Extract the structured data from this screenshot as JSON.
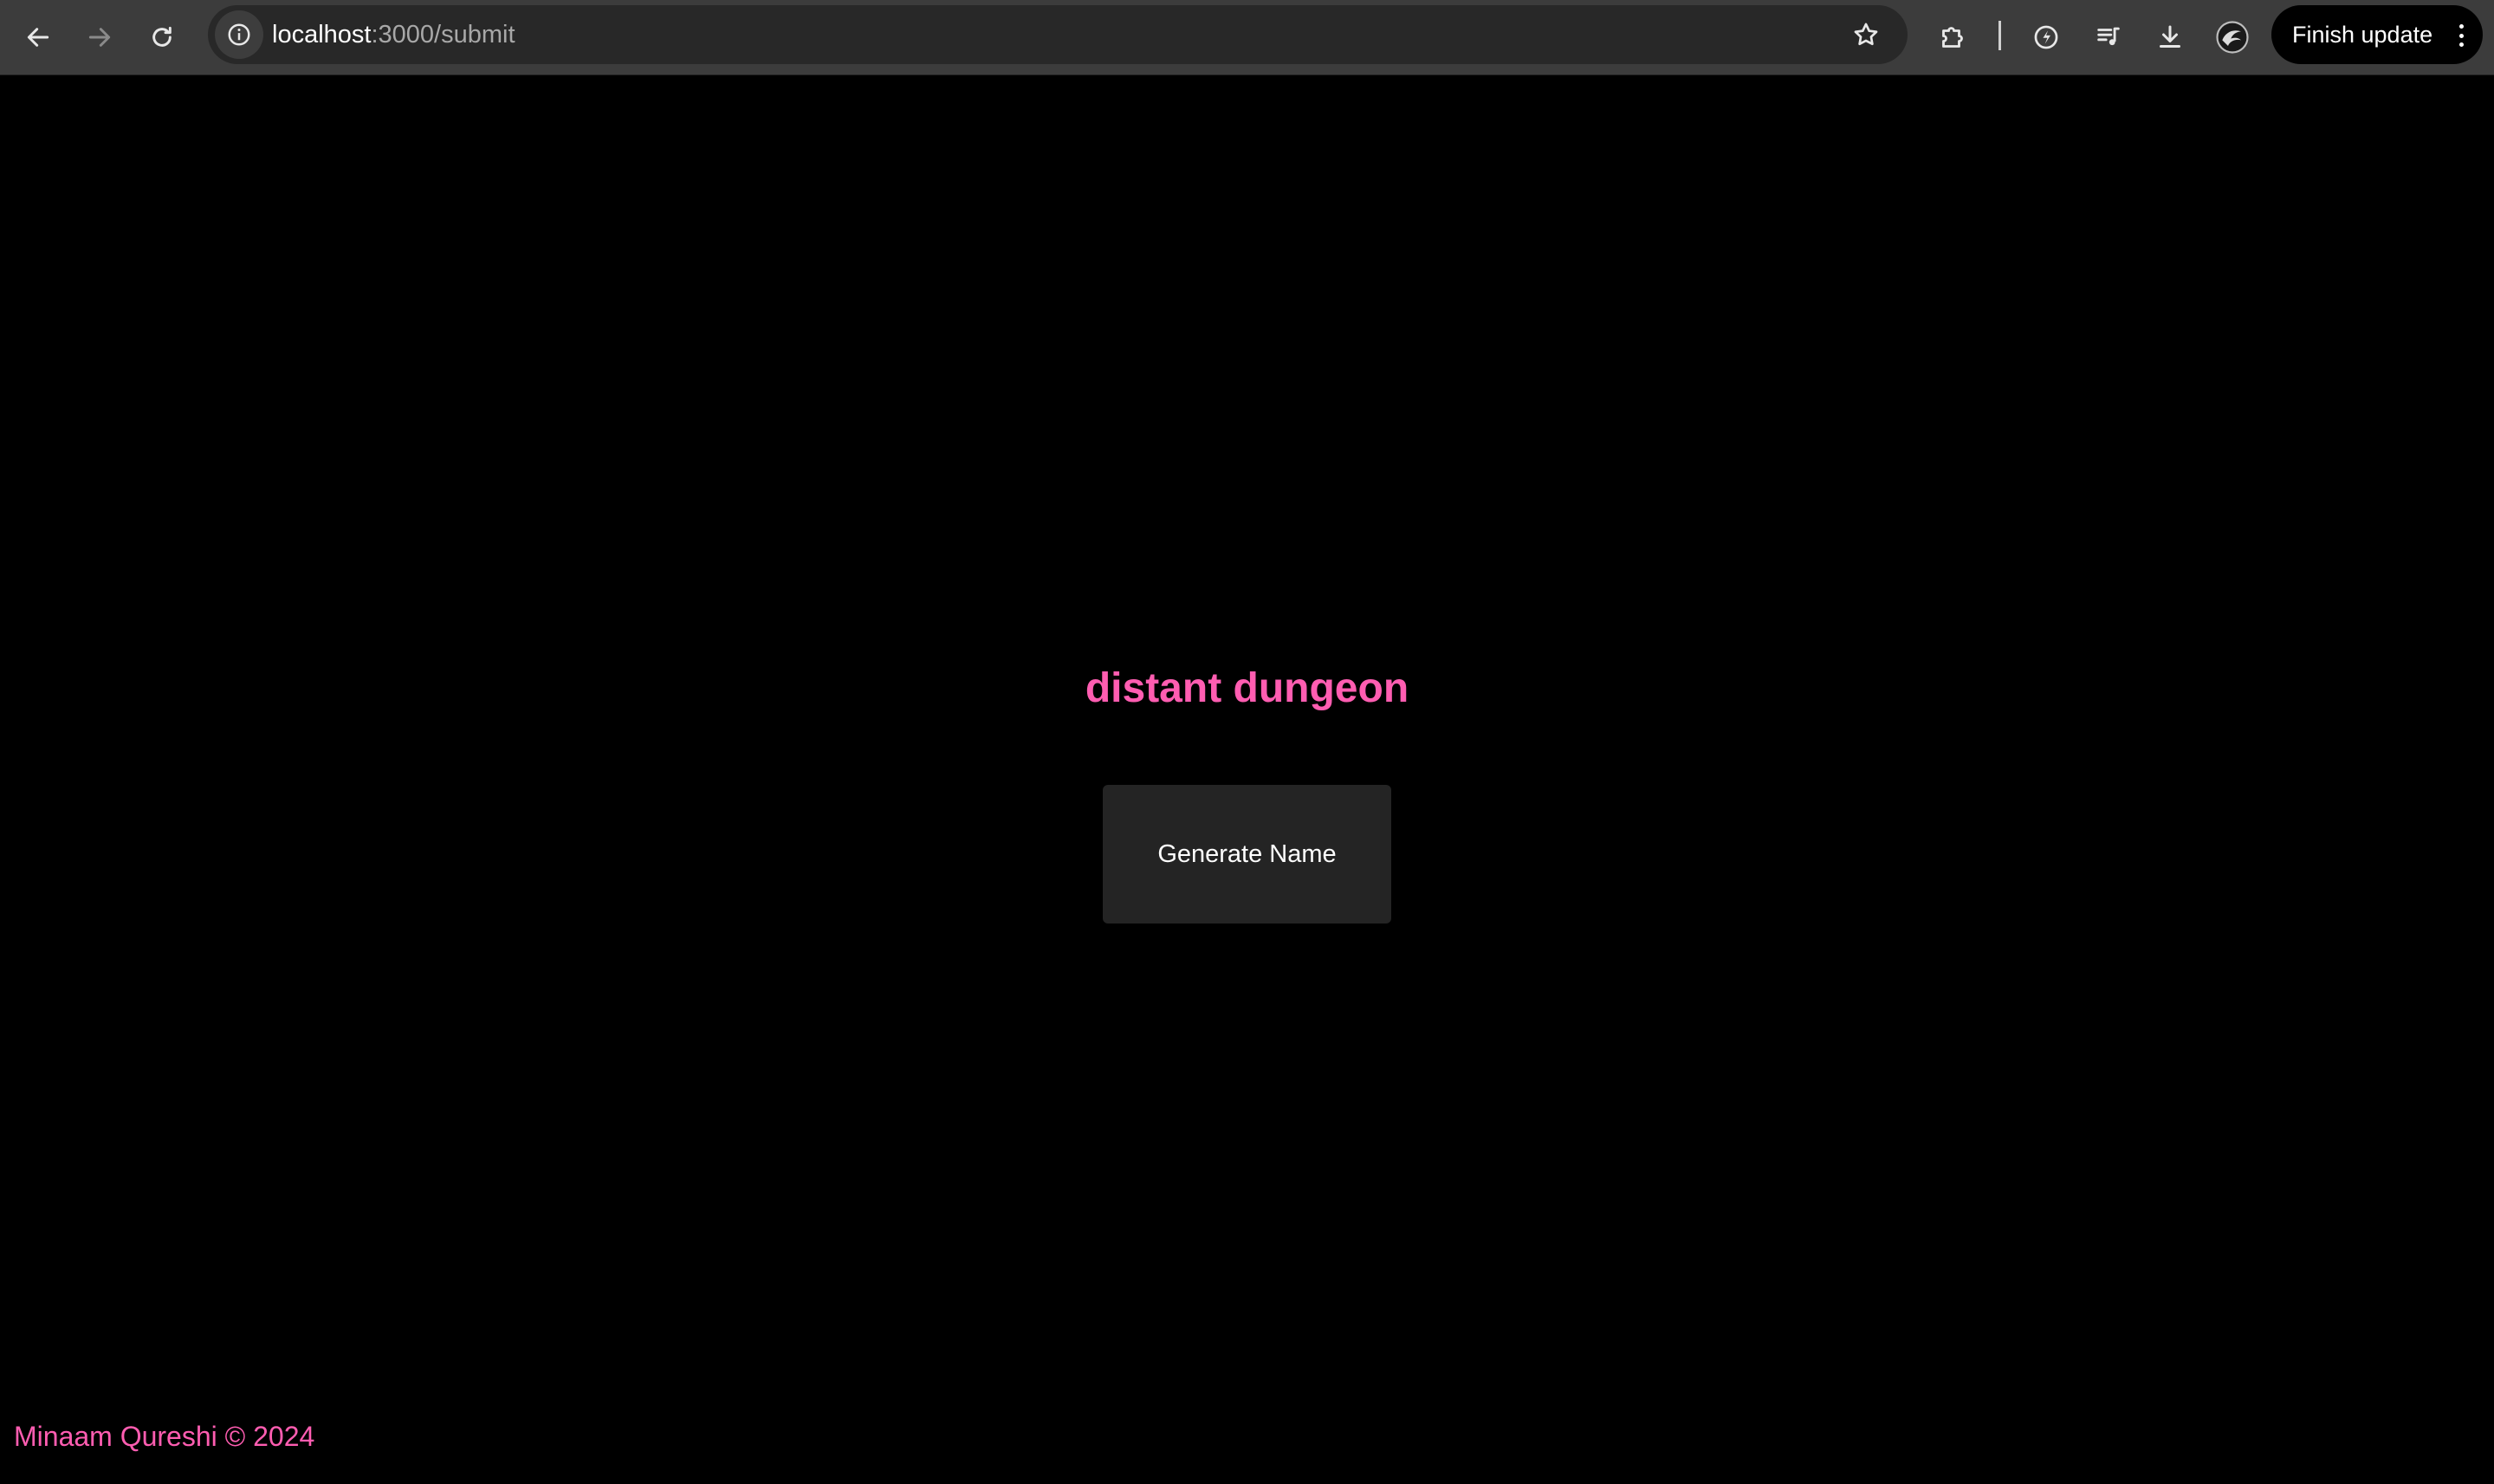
{
  "browser": {
    "url_host": "localhost",
    "url_path": ":3000/submit",
    "finish_update_label": "Finish update",
    "icons": {
      "back": "arrow-left-icon",
      "forward": "arrow-right-icon",
      "reload": "reload-icon",
      "site_info": "info-icon",
      "bookmark": "star-icon",
      "extensions": "puzzle-icon",
      "performance": "gauge-icon",
      "media": "queue-music-icon",
      "downloads": "download-icon",
      "profile": "avatar-icon",
      "menu": "kebab-menu-icon"
    }
  },
  "page": {
    "title": "distant dungeon",
    "generate_button_label": "Generate Name",
    "footer": "Minaam Qureshi © 2024",
    "accent_color": "#ff5db1",
    "background_color": "#000000",
    "button_color": "#242424"
  }
}
